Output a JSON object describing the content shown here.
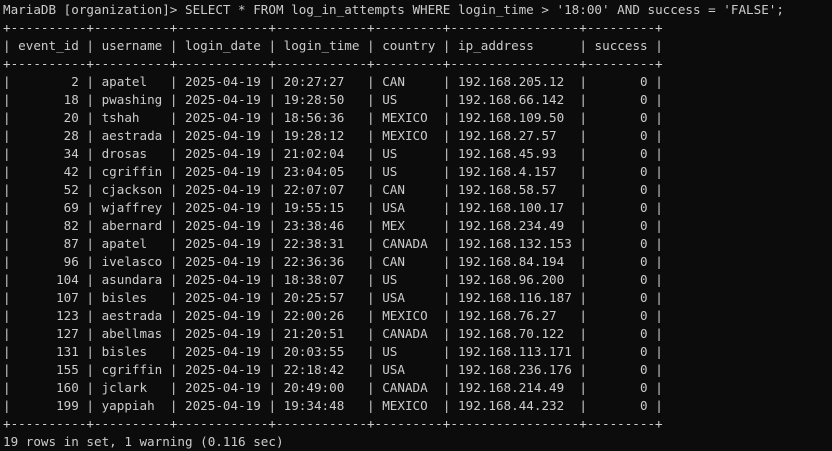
{
  "terminal": {
    "prompt": "MariaDB [organization]>",
    "query": "SELECT * FROM log_in_attempts WHERE login_time > '18:00' AND success = 'FALSE';",
    "columns": [
      "event_id",
      "username",
      "login_date",
      "login_time",
      "country",
      "ip_address",
      "success"
    ],
    "rows": [
      [
        "2",
        "apatel",
        "2025-04-19",
        "20:27:27",
        "CAN",
        "192.168.205.12",
        "0"
      ],
      [
        "18",
        "pwashing",
        "2025-04-19",
        "19:28:50",
        "US",
        "192.168.66.142",
        "0"
      ],
      [
        "20",
        "tshah",
        "2025-04-19",
        "18:56:36",
        "MEXICO",
        "192.168.109.50",
        "0"
      ],
      [
        "28",
        "aestrada",
        "2025-04-19",
        "19:28:12",
        "MEXICO",
        "192.168.27.57",
        "0"
      ],
      [
        "34",
        "drosas",
        "2025-04-19",
        "21:02:04",
        "US",
        "192.168.45.93",
        "0"
      ],
      [
        "42",
        "cgriffin",
        "2025-04-19",
        "23:04:05",
        "US",
        "192.168.4.157",
        "0"
      ],
      [
        "52",
        "cjackson",
        "2025-04-19",
        "22:07:07",
        "CAN",
        "192.168.58.57",
        "0"
      ],
      [
        "69",
        "wjaffrey",
        "2025-04-19",
        "19:55:15",
        "USA",
        "192.168.100.17",
        "0"
      ],
      [
        "82",
        "abernard",
        "2025-04-19",
        "23:38:46",
        "MEX",
        "192.168.234.49",
        "0"
      ],
      [
        "87",
        "apatel",
        "2025-04-19",
        "22:38:31",
        "CANADA",
        "192.168.132.153",
        "0"
      ],
      [
        "96",
        "ivelasco",
        "2025-04-19",
        "22:36:36",
        "CAN",
        "192.168.84.194",
        "0"
      ],
      [
        "104",
        "asundara",
        "2025-04-19",
        "18:38:07",
        "US",
        "192.168.96.200",
        "0"
      ],
      [
        "107",
        "bisles",
        "2025-04-19",
        "20:25:57",
        "USA",
        "192.168.116.187",
        "0"
      ],
      [
        "123",
        "aestrada",
        "2025-04-19",
        "22:00:26",
        "MEXICO",
        "192.168.76.27",
        "0"
      ],
      [
        "127",
        "abellmas",
        "2025-04-19",
        "21:20:51",
        "CANADA",
        "192.168.70.122",
        "0"
      ],
      [
        "131",
        "bisles",
        "2025-04-19",
        "20:03:55",
        "US",
        "192.168.113.171",
        "0"
      ],
      [
        "155",
        "cgriffin",
        "2025-04-19",
        "22:18:42",
        "USA",
        "192.168.236.176",
        "0"
      ],
      [
        "160",
        "jclark",
        "2025-04-19",
        "20:49:00",
        "CANADA",
        "192.168.214.49",
        "0"
      ],
      [
        "199",
        "yappiah",
        "2025-04-19",
        "19:34:48",
        "MEXICO",
        "192.168.44.232",
        "0"
      ]
    ],
    "status": "19 rows in set, 1 warning (0.116 sec)"
  }
}
